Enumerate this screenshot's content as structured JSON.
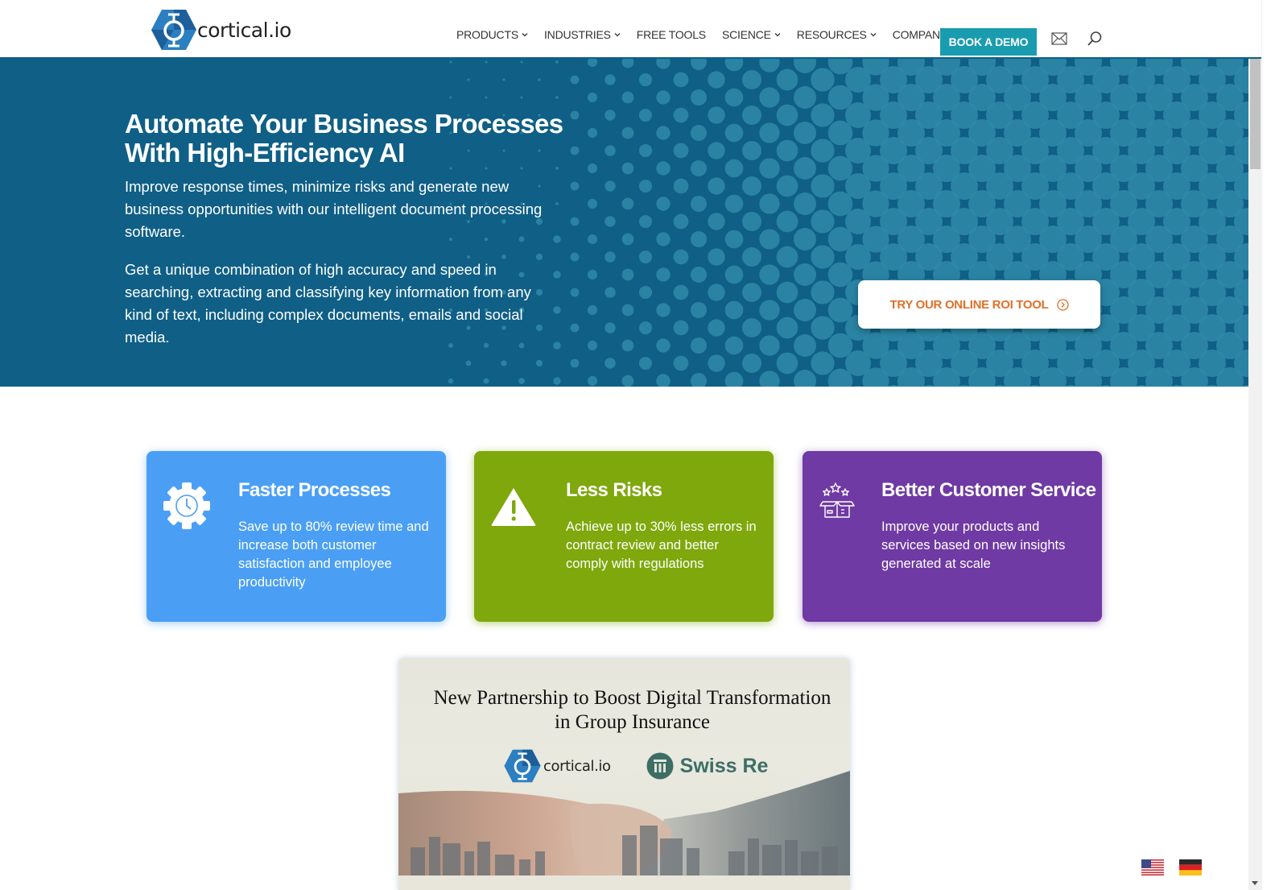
{
  "brand": {
    "name": "cortical.io",
    "primary_color": "#0f5f86",
    "accent_color": "#1a9cb0",
    "logo_color": "#2c7fc0"
  },
  "header": {
    "nav": [
      {
        "label": "PRODUCTS",
        "has_dropdown": true
      },
      {
        "label": "INDUSTRIES",
        "has_dropdown": true
      },
      {
        "label": "FREE TOOLS",
        "has_dropdown": false
      },
      {
        "label": "SCIENCE",
        "has_dropdown": true
      },
      {
        "label": "RESOURCES",
        "has_dropdown": true
      },
      {
        "label": "COMPANY",
        "has_dropdown": true
      }
    ],
    "cta_label": "BOOK A DEMO",
    "icons": [
      "mail-icon",
      "search-icon"
    ]
  },
  "hero": {
    "title": "Automate Your Business Processes With High-Efficiency AI",
    "paragraph_1": "Improve response times, minimize risks and generate new business opportunities with our intelligent document processing software.",
    "paragraph_2": "Get a unique combination of high accuracy and speed in searching, extracting and classifying key information from any kind of text, including complex documents, emails and social media.",
    "roi_button": "TRY OUR ONLINE ROI TOOL",
    "roi_color": "#e0702a"
  },
  "features": [
    {
      "title": "Faster Processes",
      "text": "Save up to 80% review time and increase both customer satisfaction and employee productivity",
      "icon": "gear-clock-icon",
      "color": "#4a9ff5"
    },
    {
      "title": "Less Risks",
      "text": "Achieve up to 30% less errors in contract review and better comply with regulations",
      "icon": "warning-icon",
      "color": "#7ea80c"
    },
    {
      "title": "Better Customer Service",
      "text": "Improve your products and services based on new insights generated at scale",
      "icon": "box-stars-icon",
      "color": "#6f3aa3"
    }
  ],
  "banner": {
    "title_line_1": "New Partnership to Boost Digital Transformation",
    "title_line_2": "in Group Insurance",
    "logo_1": "cortical.io",
    "logo_2": "Swiss Re"
  },
  "languages": [
    {
      "code": "en-US",
      "flag": "us-flag-icon"
    },
    {
      "code": "de",
      "flag": "de-flag-icon"
    }
  ]
}
